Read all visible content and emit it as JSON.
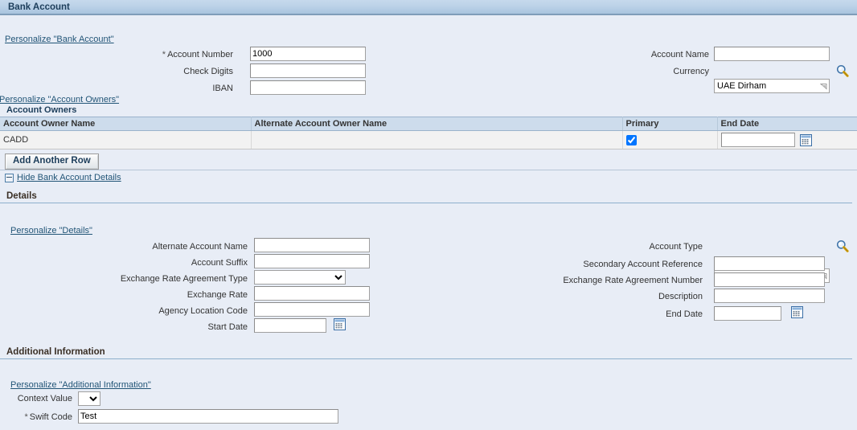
{
  "page": {
    "title": "Bank Account"
  },
  "bank_account": {
    "personalize_link": "Personalize \"Bank Account\"",
    "fields": {
      "account_number": {
        "label": "Account Number",
        "value": "1000",
        "required": true
      },
      "check_digits": {
        "label": "Check Digits",
        "value": "",
        "required": false
      },
      "iban": {
        "label": "IBAN",
        "value": "",
        "required": false
      },
      "account_name": {
        "label": "Account Name",
        "value": "",
        "required": false
      },
      "currency": {
        "label": "Currency",
        "value": "UAE Dirham",
        "required": false
      }
    }
  },
  "account_owners": {
    "personalize_link": "Personalize \"Account Owners\"",
    "caption": "Account Owners",
    "columns": [
      "Account Owner Name",
      "Alternate Account Owner Name",
      "Primary",
      "End Date"
    ],
    "rows": [
      {
        "account_owner_name": "CADD",
        "alternate_account_owner_name": "",
        "primary": true,
        "end_date": ""
      }
    ],
    "add_row_button": "Add Another Row"
  },
  "details_toggle": {
    "label": "Hide Bank Account Details",
    "expanded": true
  },
  "details": {
    "heading": "Details",
    "personalize_link": "Personalize \"Details\"",
    "fields": {
      "alternate_account_name": {
        "label": "Alternate Account Name",
        "value": ""
      },
      "account_suffix": {
        "label": "Account Suffix",
        "value": ""
      },
      "exchange_rate_agreement_type": {
        "label": "Exchange Rate Agreement Type",
        "value": ""
      },
      "exchange_rate": {
        "label": "Exchange Rate",
        "value": ""
      },
      "agency_location_code": {
        "label": "Agency Location Code",
        "value": ""
      },
      "start_date": {
        "label": "Start Date",
        "value": ""
      },
      "account_type": {
        "label": "Account Type",
        "value": ""
      },
      "secondary_account_reference": {
        "label": "Secondary Account Reference",
        "value": ""
      },
      "exchange_rate_agreement_number": {
        "label": "Exchange Rate Agreement Number",
        "value": ""
      },
      "description": {
        "label": "Description",
        "value": ""
      },
      "end_date": {
        "label": "End Date",
        "value": ""
      }
    }
  },
  "additional_information": {
    "heading": "Additional Information",
    "personalize_link": "Personalize \"Additional Information\"",
    "fields": {
      "context_value": {
        "label": "Context Value",
        "value": ""
      },
      "swift_code": {
        "label": "Swift Code",
        "value": "Test",
        "required": true
      }
    }
  },
  "icons": {
    "search": "magnifier-icon",
    "calendar": "calendar-icon",
    "collapse": "minus-box-icon"
  },
  "colors": {
    "page_bg": "#e8edf6",
    "header_grad_top": "#c6d9ec",
    "header_grad_bottom": "#a8c4de",
    "header_border": "#7f9db9",
    "link": "#225577",
    "table_header_bg": "#cddcec",
    "table_row_bg": "#f2f2f2"
  }
}
